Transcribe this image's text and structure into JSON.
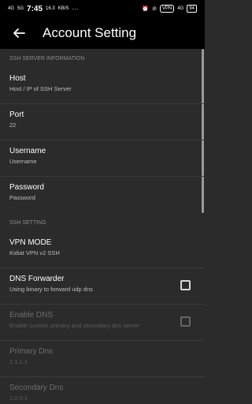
{
  "status_bar": {
    "signal1": "4G",
    "signal2": "5G",
    "time": "7:45",
    "speed_top": "16.3",
    "speed_unit": "KB/S",
    "more": "···",
    "vpn": "VPN",
    "net": "4G",
    "battery": "94"
  },
  "app_bar": {
    "title": "Account Setting"
  },
  "sections": {
    "ssh_server": {
      "header": "SSH SERVER INFORMATION"
    },
    "ssh_setting": {
      "header": "SSH SETTING"
    }
  },
  "rows": {
    "host": {
      "title": "Host",
      "subtitle": "Host / IP of SSH Server"
    },
    "port": {
      "title": "Port",
      "subtitle": "22"
    },
    "username": {
      "title": "Username",
      "subtitle": "Username"
    },
    "password": {
      "title": "Password",
      "subtitle": "Password"
    },
    "vpn_mode": {
      "title": "VPN MODE",
      "subtitle": "Kidiat VPN v2 SSH"
    },
    "dns_forwarder": {
      "title": "DNS Forwarder",
      "subtitle": "Using binary to forward udp dns"
    },
    "enable_dns": {
      "title": "Enable DNS",
      "subtitle": "Enable custom primary and secondary dns server"
    },
    "primary_dns": {
      "title": "Primary Dns",
      "subtitle": "1.1.1.1"
    },
    "secondary_dns": {
      "title": "Secondary Dns",
      "subtitle": "1.0.0.1"
    }
  },
  "checkboxes": {
    "dns_forwarder": false,
    "enable_dns": false
  }
}
